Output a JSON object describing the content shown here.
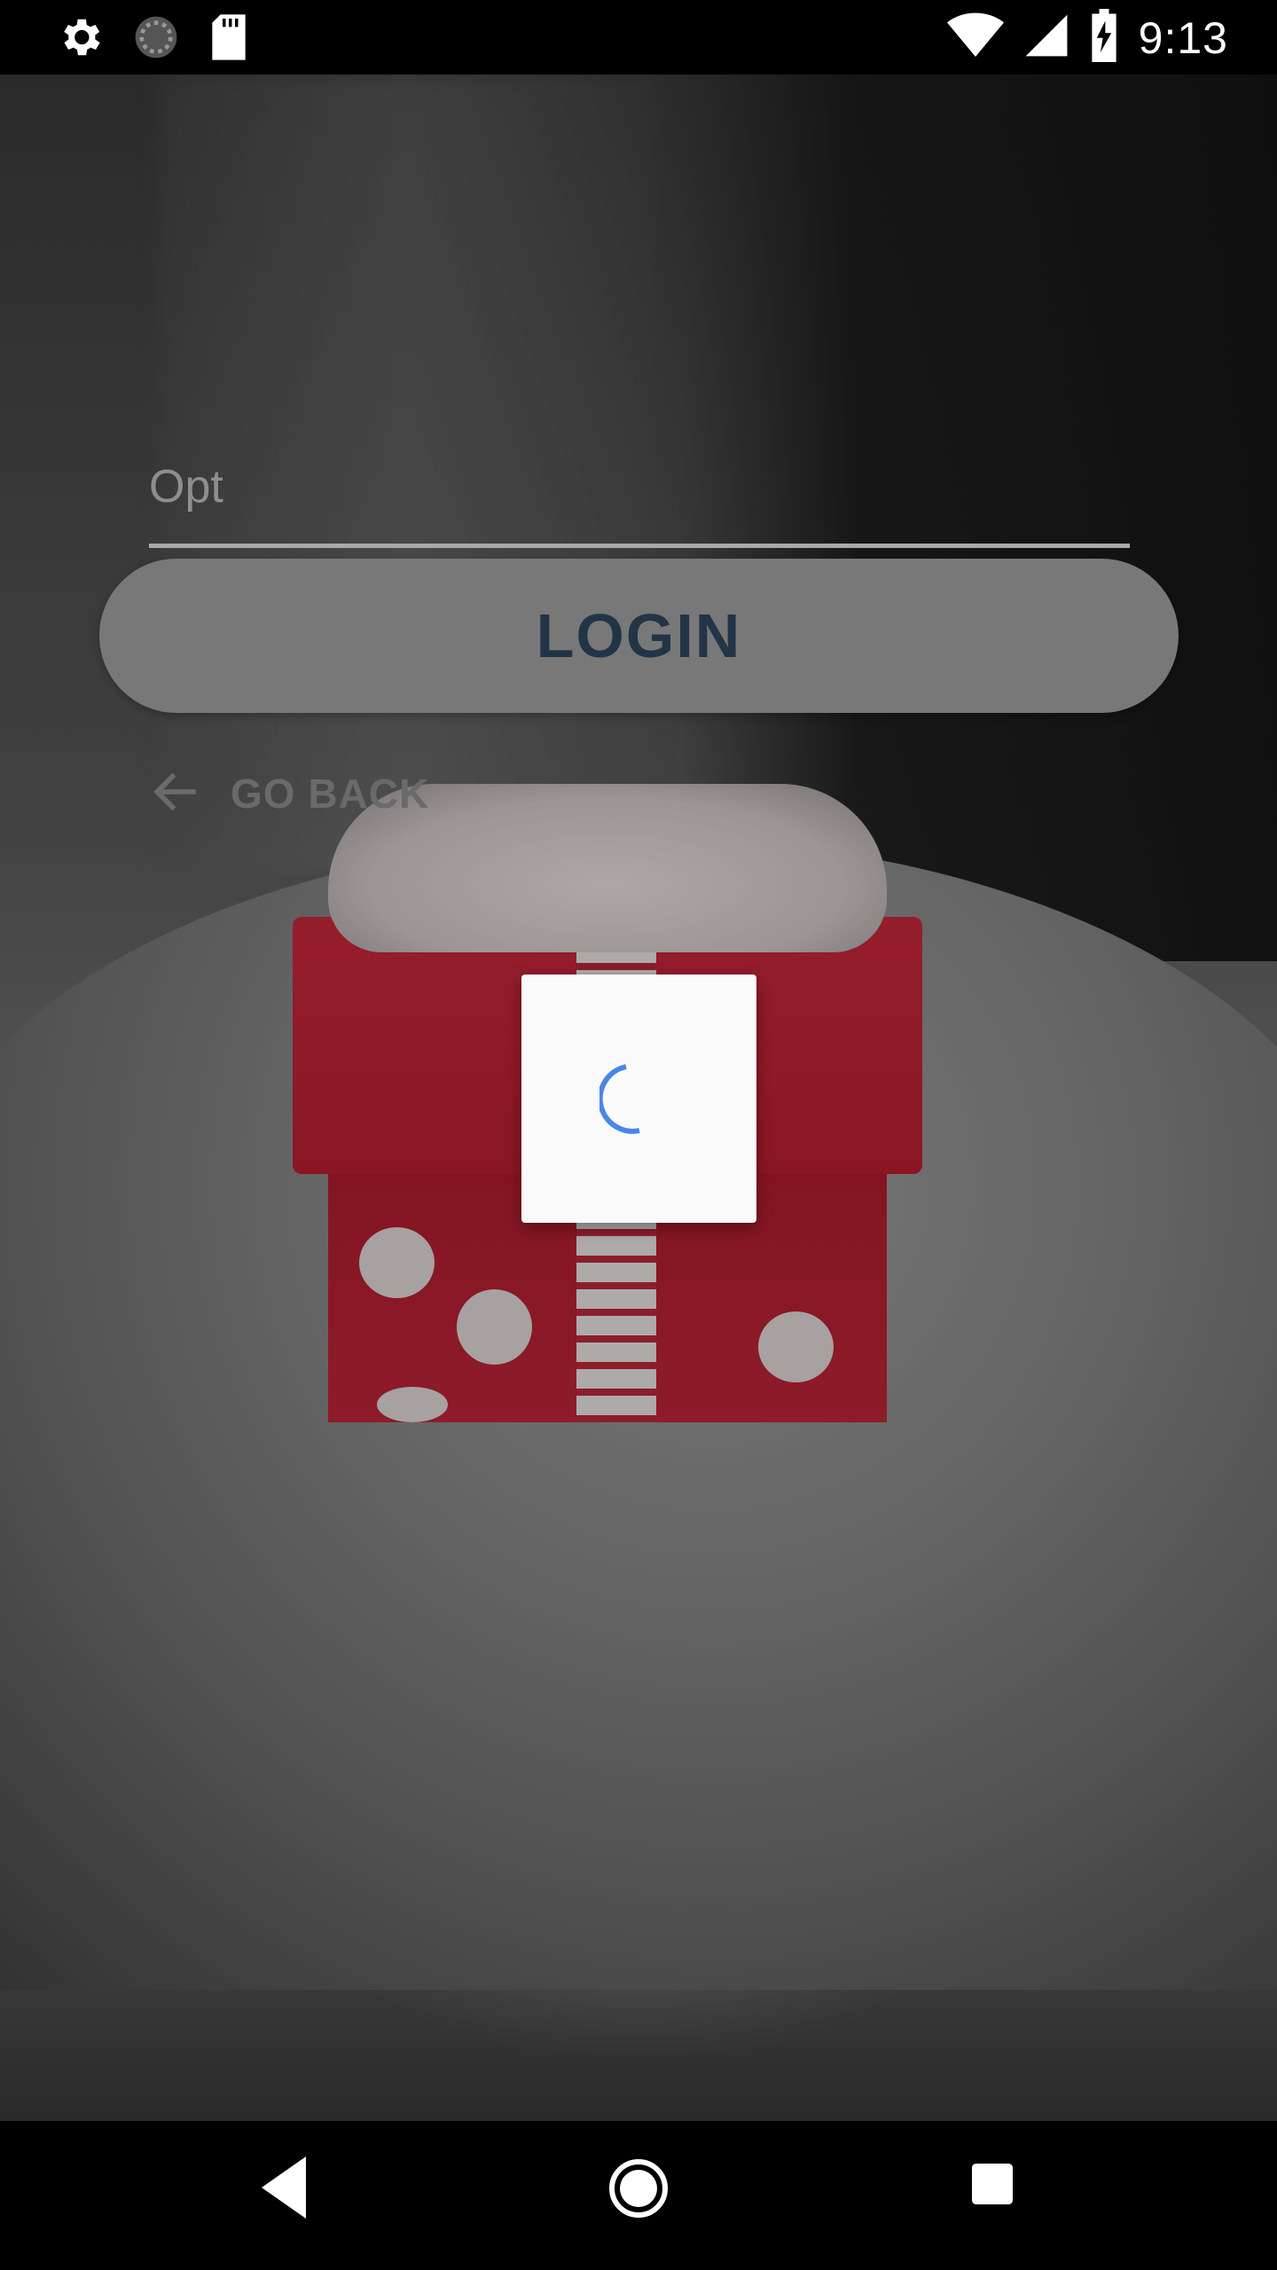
{
  "status_bar": {
    "time": "9:13",
    "left_icons": [
      "settings-icon",
      "sync-icon",
      "sd-card-icon"
    ],
    "right_icons": [
      "wifi-icon",
      "signal-icon",
      "battery-charging-icon"
    ]
  },
  "form": {
    "otp_placeholder": "Opt",
    "otp_value": "",
    "login_label": "LOGIN",
    "go_back_label": "GO BACK"
  },
  "dialog": {
    "type": "loading",
    "spinner_color": "#4a86e8"
  },
  "nav_bar": {
    "buttons": [
      "back-icon",
      "home-icon",
      "recents-icon"
    ]
  },
  "colors": {
    "login_text": "#223547",
    "login_button": "#787878"
  }
}
